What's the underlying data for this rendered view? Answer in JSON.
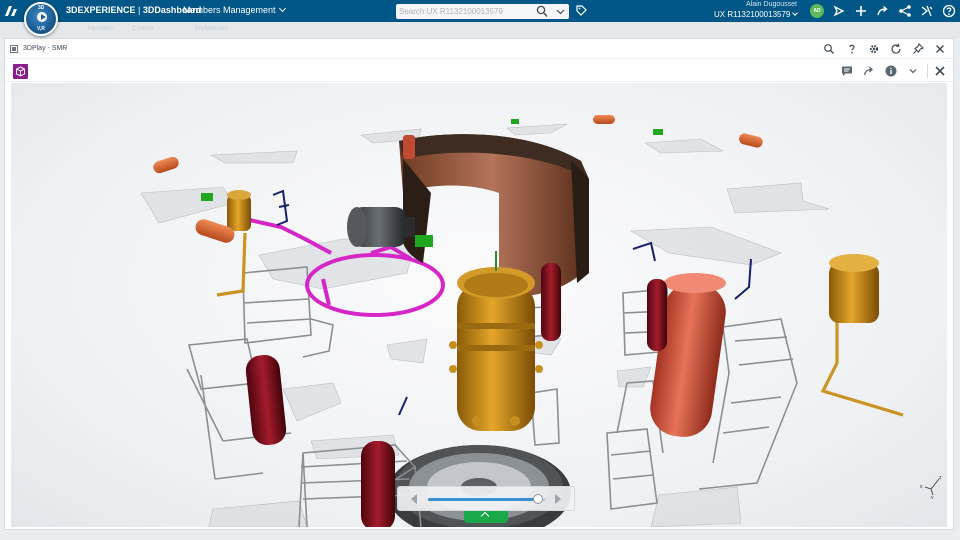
{
  "topbar": {
    "brand": "3DEXPERIENCE",
    "app": "3DDashboard",
    "dashboard_name": "Members Management",
    "compass_labels": {
      "top": "3D",
      "right": "",
      "bottom": "V,R",
      "left": ""
    },
    "search": {
      "placeholder": "Search UX R1132100013579",
      "value": ""
    },
    "user": {
      "name": "Alain Dugousset",
      "tenant": "UX R1132100013579",
      "initials": "AD"
    },
    "icons": [
      "tag-icon",
      "notifications-icon",
      "add-icon",
      "share-icon",
      "social-icon",
      "apps-icon",
      "help-icon"
    ]
  },
  "subnav": {
    "tabs": [
      "Members",
      "Content",
      "Preferences"
    ]
  },
  "widget": {
    "title": "3DPlay - SMR",
    "header_icons": [
      "search-icon",
      "help-icon",
      "settings-icon",
      "refresh-icon",
      "pin-icon",
      "close-icon"
    ],
    "toolbar_icons": [
      "comment-icon",
      "share-icon",
      "info-icon",
      "chevron-down-icon",
      "close-icon"
    ]
  },
  "player": {
    "progress": 0.93,
    "controls": [
      "previous-step-icon",
      "next-step-icon",
      "expand-panel-icon"
    ]
  },
  "triad": {
    "x": "x",
    "y": "y",
    "z": "z"
  },
  "colors": {
    "topbar": "#005686",
    "accent": "#3b8fd0",
    "app_icon": "#8b1c8e",
    "green_tab": "#18a84a"
  }
}
